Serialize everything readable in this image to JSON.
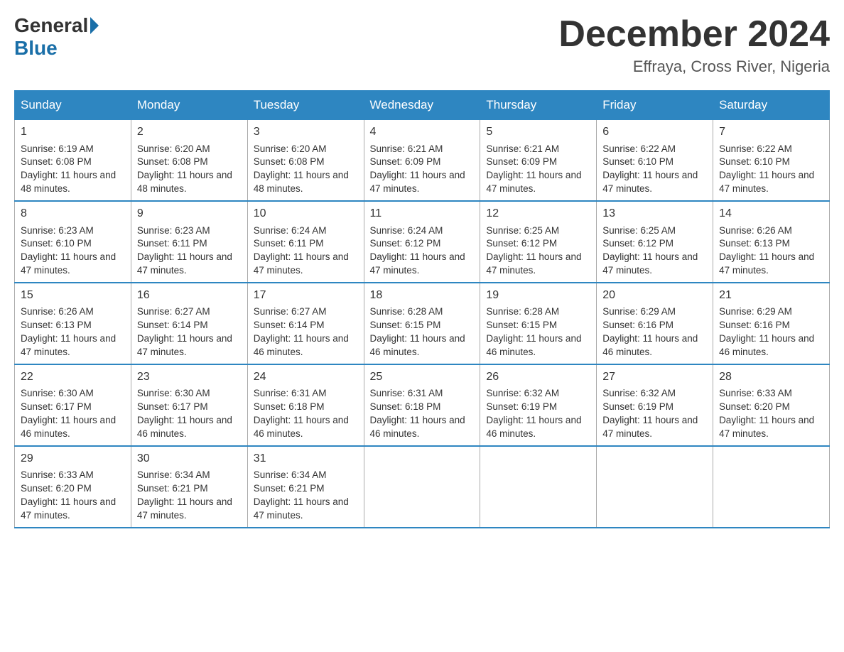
{
  "header": {
    "logo_general": "General",
    "logo_blue": "Blue",
    "month_title": "December 2024",
    "location": "Effraya, Cross River, Nigeria"
  },
  "days_of_week": [
    "Sunday",
    "Monday",
    "Tuesday",
    "Wednesday",
    "Thursday",
    "Friday",
    "Saturday"
  ],
  "weeks": [
    [
      {
        "day": "1",
        "sunrise": "6:19 AM",
        "sunset": "6:08 PM",
        "daylight": "11 hours and 48 minutes."
      },
      {
        "day": "2",
        "sunrise": "6:20 AM",
        "sunset": "6:08 PM",
        "daylight": "11 hours and 48 minutes."
      },
      {
        "day": "3",
        "sunrise": "6:20 AM",
        "sunset": "6:08 PM",
        "daylight": "11 hours and 48 minutes."
      },
      {
        "day": "4",
        "sunrise": "6:21 AM",
        "sunset": "6:09 PM",
        "daylight": "11 hours and 47 minutes."
      },
      {
        "day": "5",
        "sunrise": "6:21 AM",
        "sunset": "6:09 PM",
        "daylight": "11 hours and 47 minutes."
      },
      {
        "day": "6",
        "sunrise": "6:22 AM",
        "sunset": "6:10 PM",
        "daylight": "11 hours and 47 minutes."
      },
      {
        "day": "7",
        "sunrise": "6:22 AM",
        "sunset": "6:10 PM",
        "daylight": "11 hours and 47 minutes."
      }
    ],
    [
      {
        "day": "8",
        "sunrise": "6:23 AM",
        "sunset": "6:10 PM",
        "daylight": "11 hours and 47 minutes."
      },
      {
        "day": "9",
        "sunrise": "6:23 AM",
        "sunset": "6:11 PM",
        "daylight": "11 hours and 47 minutes."
      },
      {
        "day": "10",
        "sunrise": "6:24 AM",
        "sunset": "6:11 PM",
        "daylight": "11 hours and 47 minutes."
      },
      {
        "day": "11",
        "sunrise": "6:24 AM",
        "sunset": "6:12 PM",
        "daylight": "11 hours and 47 minutes."
      },
      {
        "day": "12",
        "sunrise": "6:25 AM",
        "sunset": "6:12 PM",
        "daylight": "11 hours and 47 minutes."
      },
      {
        "day": "13",
        "sunrise": "6:25 AM",
        "sunset": "6:12 PM",
        "daylight": "11 hours and 47 minutes."
      },
      {
        "day": "14",
        "sunrise": "6:26 AM",
        "sunset": "6:13 PM",
        "daylight": "11 hours and 47 minutes."
      }
    ],
    [
      {
        "day": "15",
        "sunrise": "6:26 AM",
        "sunset": "6:13 PM",
        "daylight": "11 hours and 47 minutes."
      },
      {
        "day": "16",
        "sunrise": "6:27 AM",
        "sunset": "6:14 PM",
        "daylight": "11 hours and 47 minutes."
      },
      {
        "day": "17",
        "sunrise": "6:27 AM",
        "sunset": "6:14 PM",
        "daylight": "11 hours and 46 minutes."
      },
      {
        "day": "18",
        "sunrise": "6:28 AM",
        "sunset": "6:15 PM",
        "daylight": "11 hours and 46 minutes."
      },
      {
        "day": "19",
        "sunrise": "6:28 AM",
        "sunset": "6:15 PM",
        "daylight": "11 hours and 46 minutes."
      },
      {
        "day": "20",
        "sunrise": "6:29 AM",
        "sunset": "6:16 PM",
        "daylight": "11 hours and 46 minutes."
      },
      {
        "day": "21",
        "sunrise": "6:29 AM",
        "sunset": "6:16 PM",
        "daylight": "11 hours and 46 minutes."
      }
    ],
    [
      {
        "day": "22",
        "sunrise": "6:30 AM",
        "sunset": "6:17 PM",
        "daylight": "11 hours and 46 minutes."
      },
      {
        "day": "23",
        "sunrise": "6:30 AM",
        "sunset": "6:17 PM",
        "daylight": "11 hours and 46 minutes."
      },
      {
        "day": "24",
        "sunrise": "6:31 AM",
        "sunset": "6:18 PM",
        "daylight": "11 hours and 46 minutes."
      },
      {
        "day": "25",
        "sunrise": "6:31 AM",
        "sunset": "6:18 PM",
        "daylight": "11 hours and 46 minutes."
      },
      {
        "day": "26",
        "sunrise": "6:32 AM",
        "sunset": "6:19 PM",
        "daylight": "11 hours and 46 minutes."
      },
      {
        "day": "27",
        "sunrise": "6:32 AM",
        "sunset": "6:19 PM",
        "daylight": "11 hours and 47 minutes."
      },
      {
        "day": "28",
        "sunrise": "6:33 AM",
        "sunset": "6:20 PM",
        "daylight": "11 hours and 47 minutes."
      }
    ],
    [
      {
        "day": "29",
        "sunrise": "6:33 AM",
        "sunset": "6:20 PM",
        "daylight": "11 hours and 47 minutes."
      },
      {
        "day": "30",
        "sunrise": "6:34 AM",
        "sunset": "6:21 PM",
        "daylight": "11 hours and 47 minutes."
      },
      {
        "day": "31",
        "sunrise": "6:34 AM",
        "sunset": "6:21 PM",
        "daylight": "11 hours and 47 minutes."
      },
      null,
      null,
      null,
      null
    ]
  ],
  "labels": {
    "sunrise": "Sunrise:",
    "sunset": "Sunset:",
    "daylight": "Daylight:"
  }
}
